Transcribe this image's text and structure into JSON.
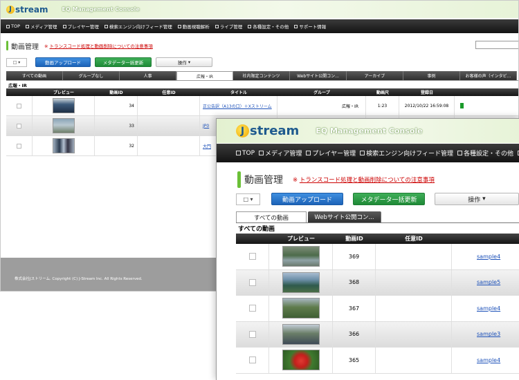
{
  "back": {
    "logo": "stream",
    "logo_letter": "J",
    "title": "EQ Management Console",
    "nav": [
      "TOP",
      "メディア管理",
      "プレイヤー管理",
      "検索エンジン向けフィード管理",
      "動画視聴解析",
      "ライブ管理",
      "各種設定・その他",
      "サポート情報"
    ],
    "page_title": "動画管理",
    "warning_mark": "※",
    "warning_link": "トランスコード処理と動画削除についての注意事項",
    "upload": "動画アップロード",
    "meta": "メタデータ一括更新",
    "ops": "操作",
    "tabs": [
      "すべての動画",
      "グループなし",
      "人事",
      "広報・IR",
      "社内限定コンテンツ",
      "Webサイト公開コン...",
      "アーカイブ",
      "事例",
      "お客様の声（インタビ..."
    ],
    "section": "広報・IR",
    "headers": [
      "プレビュー",
      "動画ID",
      "任意ID",
      "タイトル",
      "グループ",
      "動画尺",
      "登録日"
    ],
    "rows": [
      {
        "id": "34",
        "title": "正公告訳（A13の口）＋Xストリーム",
        "group": "広報・IR",
        "dur": "1:23",
        "date": "2012/10/22 16:59:08"
      },
      {
        "id": "33",
        "title": "JP0",
        "group": "",
        "dur": "",
        "date": ""
      },
      {
        "id": "32",
        "title": "大門",
        "group": "",
        "dur": "",
        "date": ""
      }
    ],
    "footer": "株式会社Jストリーム. Copyright (C) J-Stream Inc. All Rights Reserved."
  },
  "front": {
    "logo": "stream",
    "logo_letter": "J",
    "title": "EQ Management Console",
    "nav": [
      "TOP",
      "メディア管理",
      "プレイヤー管理",
      "検索エンジン向けフィード管理",
      "各種設定・その他",
      "サポート情"
    ],
    "page_title": "動画管理",
    "warning_mark": "※",
    "warning_link": "トランスコード処理と動画削除についての注意事項",
    "upload": "動画アップロード",
    "meta": "メタデータ一括更新",
    "ops": "操作",
    "tabs": [
      "すべての動画",
      "Webサイト公開コン..."
    ],
    "section": "すべての動画",
    "headers": [
      "プレビュー",
      "動画ID",
      "任意ID"
    ],
    "rows": [
      {
        "id": "369",
        "sample": "sample4"
      },
      {
        "id": "368",
        "sample": "sample5"
      },
      {
        "id": "367",
        "sample": "sample4"
      },
      {
        "id": "366",
        "sample": "sample3"
      },
      {
        "id": "365",
        "sample": "sample4"
      }
    ]
  },
  "colors": {
    "accent_green": "#6bc037",
    "nav_dark": "#1a1a1a",
    "blue_btn": "#1c63b8",
    "green_btn": "#1f8a37",
    "warning": "#cc0000"
  }
}
